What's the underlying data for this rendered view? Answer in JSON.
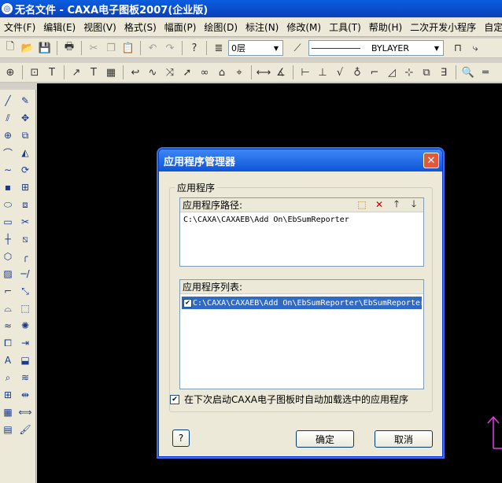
{
  "window": {
    "title": "无名文件 - CAXA电子图板2007(企业版)",
    "app_icon": "caxa-logo-icon"
  },
  "menu": [
    "文件(F)",
    "编辑(E)",
    "视图(V)",
    "格式(S)",
    "幅面(P)",
    "绘图(D)",
    "标注(N)",
    "修改(M)",
    "工具(T)",
    "帮助(H)",
    "二次开发小程序",
    "自定义"
  ],
  "toolbar1": {
    "layer_value": "0层",
    "linetype_value": "BYLAYER"
  },
  "dialog": {
    "title": "应用程序管理器",
    "group_label": "应用程序",
    "path_label": "应用程序路径:",
    "path_value": "C:\\CAXA\\CAXAEB\\Add On\\EbSumReporter",
    "list_label": "应用程序列表:",
    "list_items": [
      "C:\\CAXA\\CAXAEB\\Add On\\EbSumReporter\\EbSumReporter"
    ],
    "autoload_label": "在下次启动CAXA电子图板时自动加载选中的应用程序",
    "autoload_checked": true,
    "ok_label": "确定",
    "cancel_label": "取消",
    "help_label": "?"
  },
  "colors": {
    "canvas": "#000000",
    "ucs": "#e040e0",
    "accent": "#0a3fb8",
    "selection": "#316ac5"
  }
}
